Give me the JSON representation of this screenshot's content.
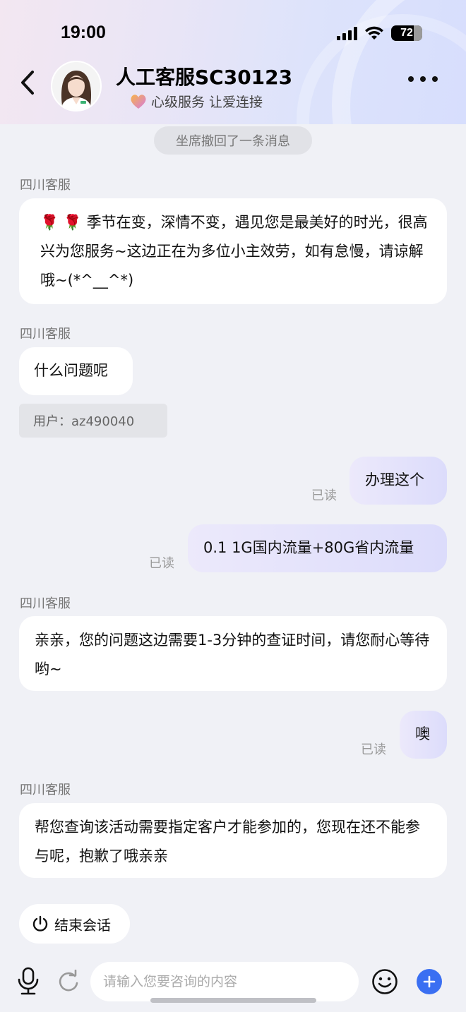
{
  "status_bar": {
    "time": "19:00",
    "battery": "72"
  },
  "header": {
    "agent_name": "人工客服SC30123",
    "slogan": "心级服务 让爱连接",
    "back_icon": "chevron-left-icon",
    "more_icon": "more-dots-icon"
  },
  "chat": {
    "recall_notice": "坐席撤回了一条消息",
    "messages": [
      {
        "sender": "四川客服",
        "direction": "in",
        "text": "🌹 🌹 季节在变，深情不变，遇见您是最美好的时光，很高兴为您服务~这边正在为多位小主效劳，如有怠慢，请谅解哦~(*^__^*)"
      },
      {
        "sender": "四川客服",
        "direction": "in",
        "text": "什么问题呢"
      },
      {
        "direction": "out",
        "text": "办理这个",
        "status": "已读"
      },
      {
        "direction": "out",
        "text": "0.1 1G国内流量+80G省内流量",
        "status": "已读"
      },
      {
        "sender": "四川客服",
        "direction": "in",
        "text": "亲亲，您的问题这边需要1-3分钟的查证时间，请您耐心等待哟~"
      },
      {
        "direction": "out",
        "text": "噢",
        "status": "已读"
      },
      {
        "sender": "四川客服",
        "direction": "in",
        "text": "帮您查询该活动需要指定客户才能参加的，您现在还不能参与呢，抱歉了哦亲亲"
      }
    ],
    "user_id_label": "用户：az490040",
    "end_session_label": "结束会话"
  },
  "input": {
    "placeholder": "请输入您要咨询的内容",
    "value": ""
  },
  "colors": {
    "accent": "#3a6ff2",
    "out_bubble": "#dcdcfb",
    "background": "#f0f1f6"
  }
}
